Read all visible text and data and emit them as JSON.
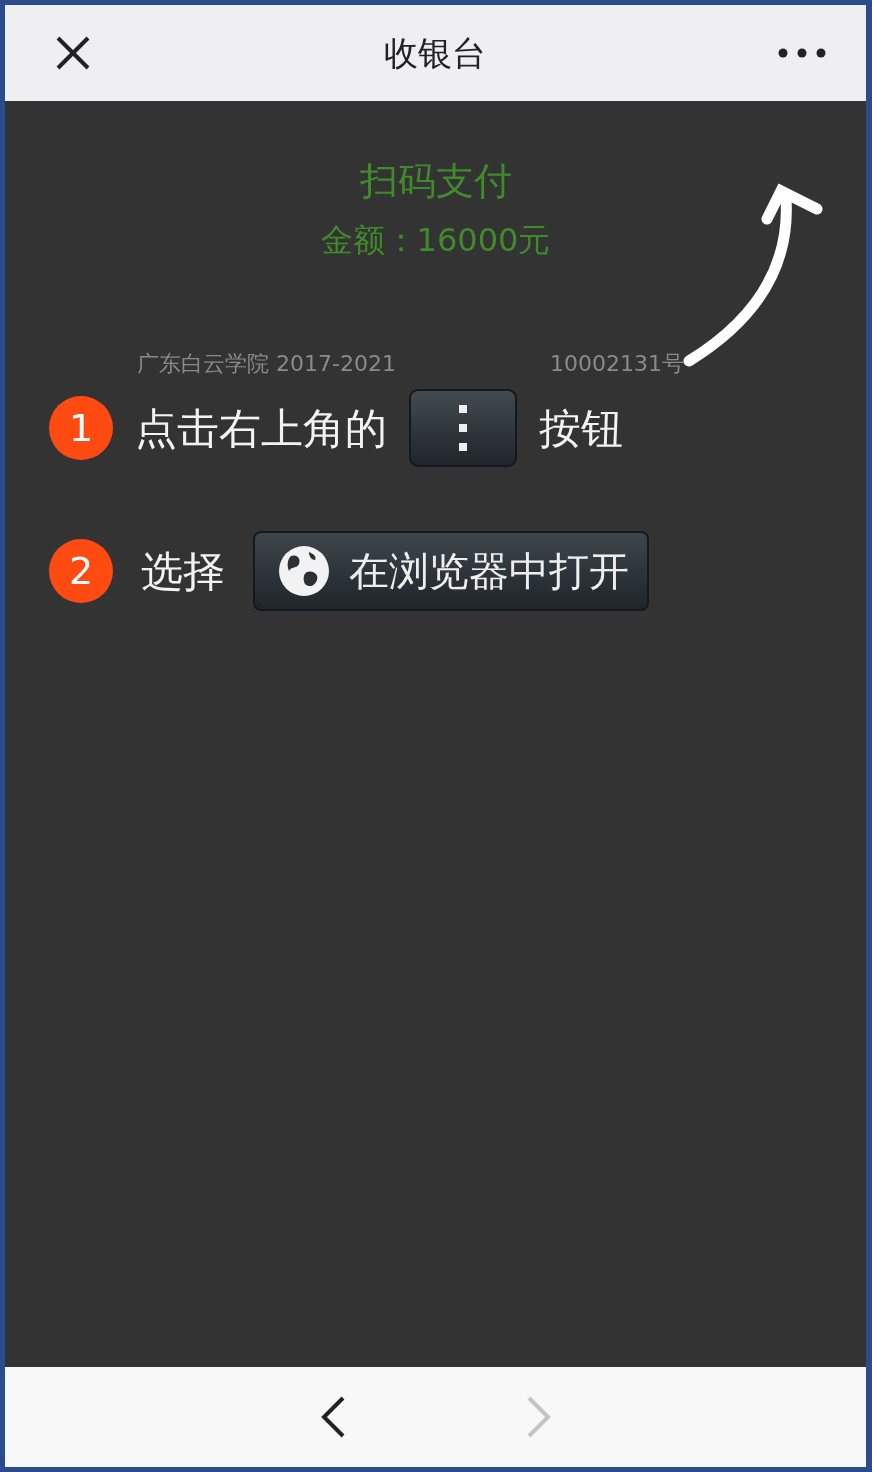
{
  "nav_bar": {
    "title": "收银台"
  },
  "page": {
    "heading": "扫码支付",
    "amount": "金额：16000元",
    "footer_parts": [
      "广东白云学院 2017-2021",
      "10002131号"
    ]
  },
  "guide": {
    "steps": [
      {
        "number": "1",
        "kind": "menu",
        "before": "点击右上角的",
        "after": "按钮"
      },
      {
        "number": "2",
        "kind": "browser",
        "before": "选择",
        "button_label": "在浏览器中打开"
      }
    ]
  },
  "toolbar": {
    "back": {
      "disabled": false
    },
    "forward": {
      "disabled": true
    }
  }
}
